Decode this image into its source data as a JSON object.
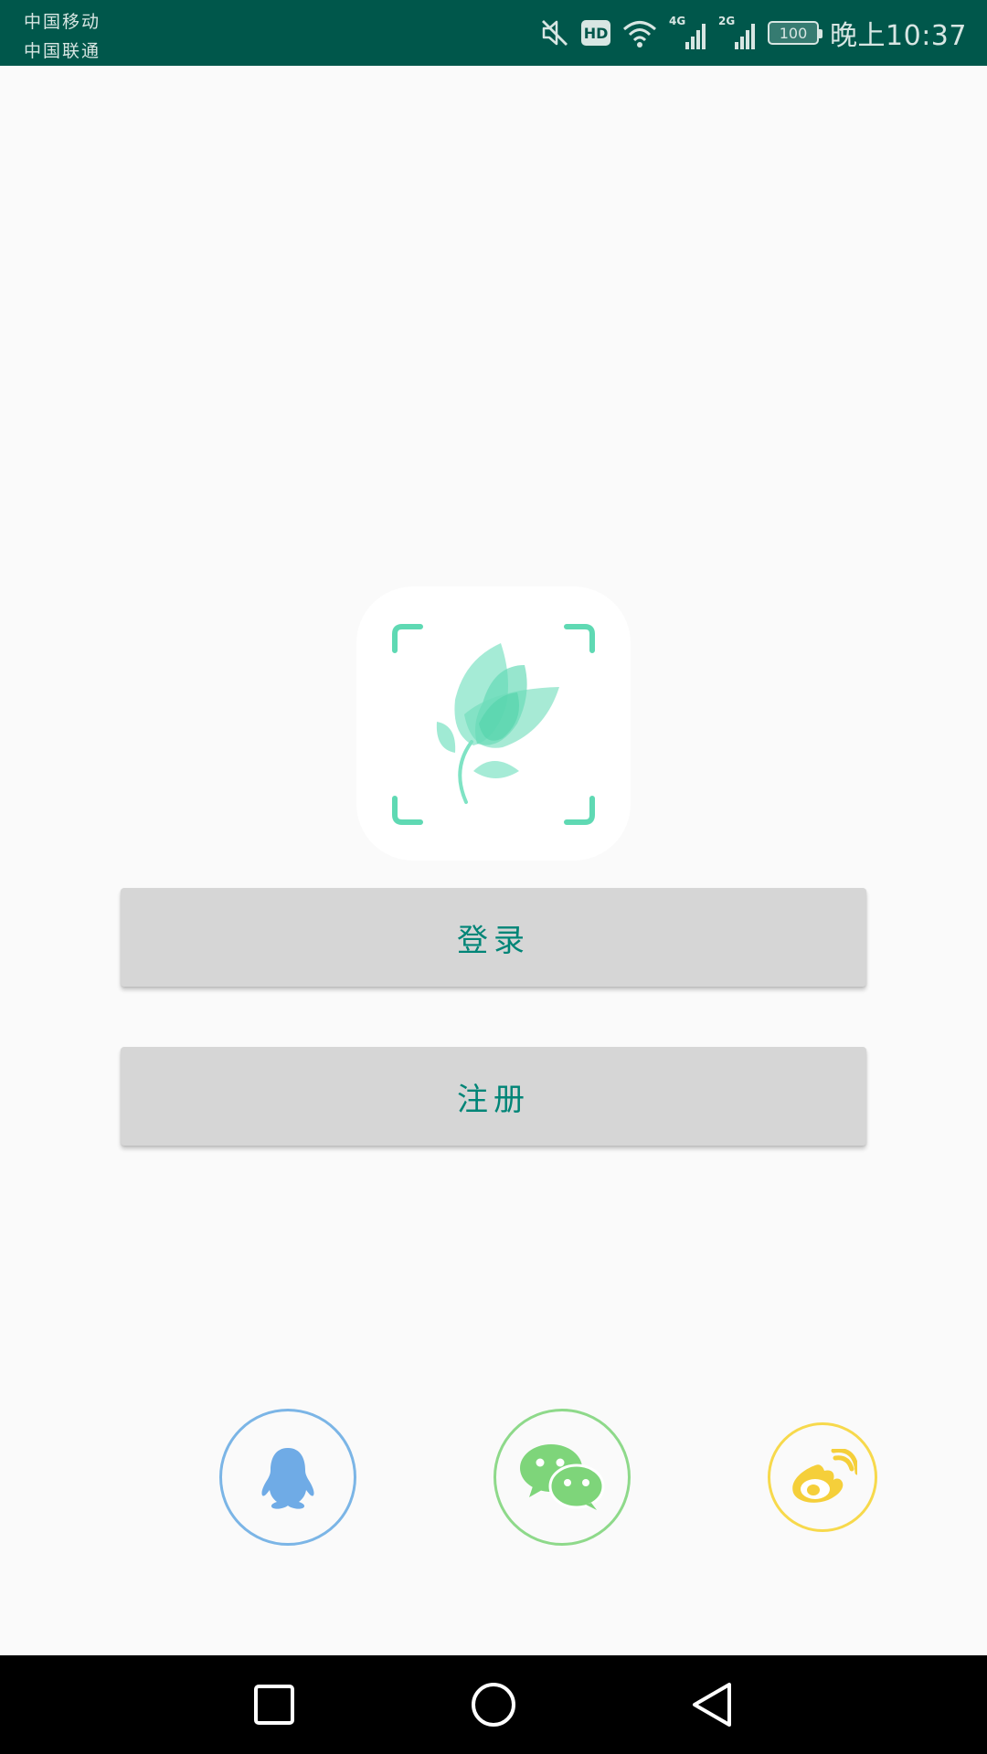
{
  "status_bar": {
    "carrier_1": "中国移动",
    "carrier_2": "中国联通",
    "hd_label": "HD",
    "net_1": "4G",
    "net_2": "2G",
    "battery": "100",
    "time": "晚上10:37",
    "icons": [
      "mute-icon",
      "hd-icon",
      "wifi-icon",
      "signal-4g-icon",
      "signal-2g-icon",
      "battery-icon"
    ]
  },
  "logo": {
    "icon": "flower-scan-icon"
  },
  "buttons": {
    "login_label": "登录",
    "register_label": "注册"
  },
  "social": {
    "items": [
      {
        "icon": "qq-icon",
        "color": "#7bb5e6"
      },
      {
        "icon": "wechat-icon",
        "color": "#8ed98a"
      },
      {
        "icon": "weibo-icon",
        "color": "#f7d94c"
      }
    ]
  },
  "nav": {
    "icons": [
      "recent-apps-icon",
      "home-icon",
      "back-icon"
    ]
  },
  "colors": {
    "status_bar": "#00574b",
    "accent": "#008577",
    "logo_green": "#5fd9b3",
    "button_bg": "#d6d6d6",
    "page_bg": "#fafafa"
  }
}
